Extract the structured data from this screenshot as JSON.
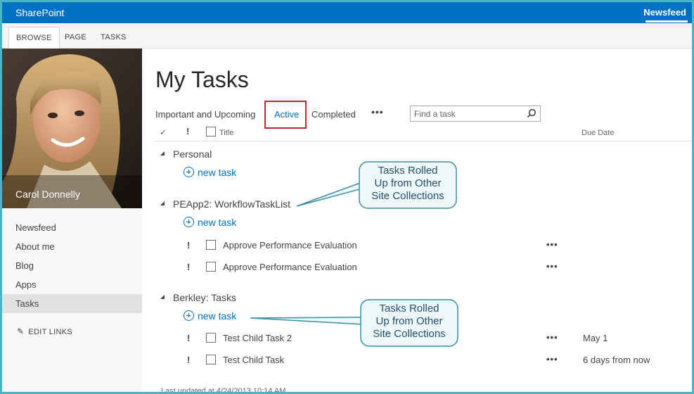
{
  "suite_bar": {
    "brand": "SharePoint",
    "newsfeed": "Newsfeed"
  },
  "ribbon": {
    "tabs": [
      {
        "label": "BROWSE"
      },
      {
        "label": "PAGE"
      },
      {
        "label": "TASKS"
      }
    ]
  },
  "profile": {
    "name": "Carol Donnelly"
  },
  "sidebar": {
    "items": [
      {
        "label": "Newsfeed"
      },
      {
        "label": "About me"
      },
      {
        "label": "Blog"
      },
      {
        "label": "Apps"
      },
      {
        "label": "Tasks"
      }
    ],
    "edit_links": "EDIT LINKS"
  },
  "page": {
    "title": "My Tasks",
    "pivots": [
      {
        "label": "Important and Upcoming"
      },
      {
        "label": "Active"
      },
      {
        "label": "Completed"
      }
    ],
    "more": "•••",
    "search_placeholder": "Find a task"
  },
  "columns": {
    "check": "✓",
    "important": "!",
    "title": "Title",
    "due": "Due Date"
  },
  "groups": [
    {
      "name": "Personal",
      "new_task": "new task",
      "tasks": []
    },
    {
      "name": "PEApp2: WorkflowTaskList",
      "new_task": "new task",
      "tasks": [
        {
          "important": "!",
          "title": "Approve Performance Evaluation",
          "more": "•••",
          "due": ""
        },
        {
          "important": "!",
          "title": "Approve Performance Evaluation",
          "more": "•••",
          "due": ""
        }
      ]
    },
    {
      "name": "Berkley: Tasks",
      "new_task": "new task",
      "tasks": [
        {
          "important": "!",
          "title": "Test Child Task 2",
          "more": "•••",
          "due": "May 1"
        },
        {
          "important": "!",
          "title": "Test Child Task",
          "more": "•••",
          "due": "6 days from now"
        }
      ]
    }
  ],
  "callouts": [
    {
      "lines": [
        "Tasks Rolled",
        "Up from Other",
        "Site Collections"
      ]
    },
    {
      "lines": [
        "Tasks Rolled",
        "Up from Other",
        "Site Collections"
      ]
    }
  ],
  "footer": {
    "last_updated": "Last updated at 4/24/2013 10:14 AM"
  },
  "colors": {
    "suite_bar": "#0072c6",
    "link": "#0072c6",
    "frame": "#4ab3c6",
    "callout_fill": "#eef8fb",
    "callout_border": "#3a8ea3",
    "highlight_box": "#b42c2c"
  }
}
